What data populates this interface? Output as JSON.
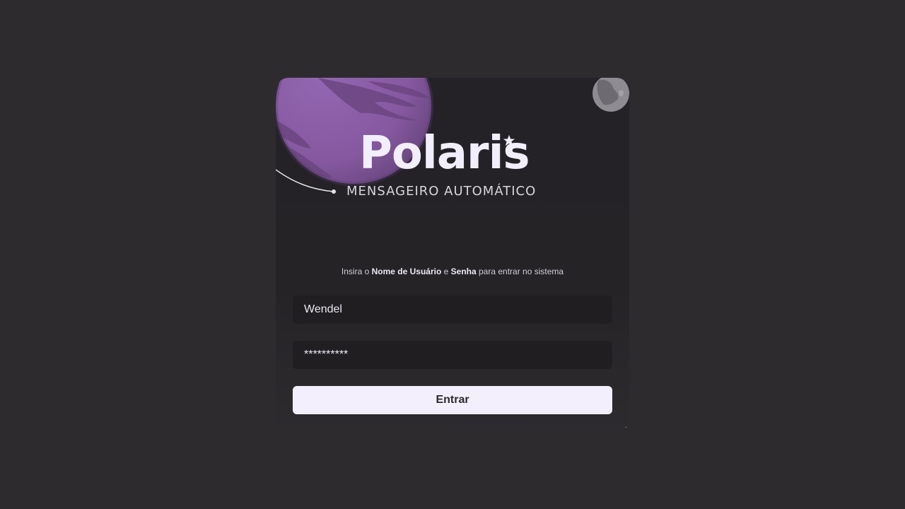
{
  "brand": {
    "name": "Polaris",
    "tagline": "MENSAGEIRO AUTOMÁTICO"
  },
  "login": {
    "instruction": {
      "prefix": "Insira o ",
      "username_term": "Nome de Usuário",
      "joiner": " e ",
      "password_term": "Senha",
      "suffix": " para entrar no sistema"
    },
    "username": {
      "value": "Wendel"
    },
    "password": {
      "value": "**********"
    },
    "submit_label": "Entrar"
  },
  "colors": {
    "background": "#2d2b2e",
    "card": "#242226",
    "planet": "#8a5fa8",
    "field": "#201e21",
    "button": "#f4effd",
    "button_text": "#2c2a2e",
    "logo_text": "#f3eefb"
  },
  "icons": {
    "planet": "planet-illustration",
    "moon": "moon-illustration",
    "logo_star": "star-icon"
  }
}
